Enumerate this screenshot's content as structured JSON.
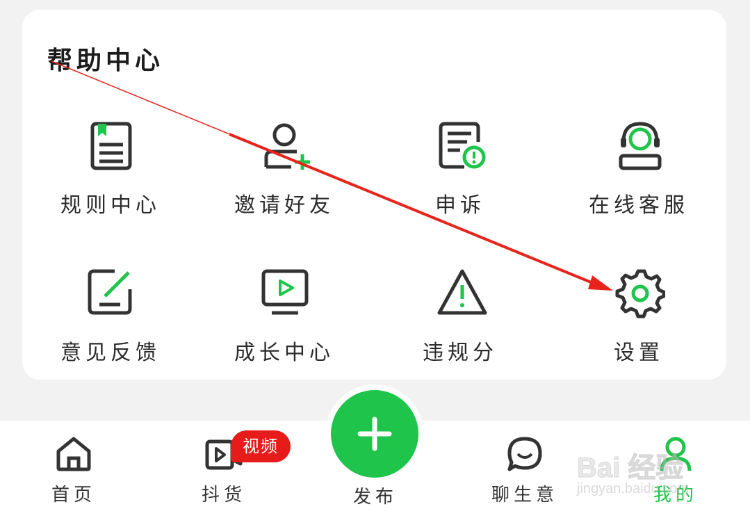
{
  "help_center": {
    "title": "帮助中心",
    "items": [
      {
        "label": "规则中心",
        "icon": "rules-book-icon"
      },
      {
        "label": "邀请好友",
        "icon": "invite-friend-icon"
      },
      {
        "label": "申诉",
        "icon": "appeal-document-icon"
      },
      {
        "label": "在线客服",
        "icon": "customer-service-headset-icon"
      },
      {
        "label": "意见反馈",
        "icon": "feedback-edit-icon"
      },
      {
        "label": "成长中心",
        "icon": "growth-video-icon"
      },
      {
        "label": "违规分",
        "icon": "violation-warning-icon"
      },
      {
        "label": "设置",
        "icon": "settings-gear-icon"
      }
    ]
  },
  "tabbar": {
    "home": "首页",
    "goods": "抖货",
    "goods_badge": "视频",
    "publish": "发布",
    "chat": "聊生意",
    "mine": "我的"
  },
  "watermark": {
    "brand": "Bai 经验",
    "url": "jingyan.baidu.com"
  },
  "colors": {
    "accent_green": "#1fc44a",
    "badge_red": "#e81b1b",
    "annotation_red": "#e8231b"
  }
}
